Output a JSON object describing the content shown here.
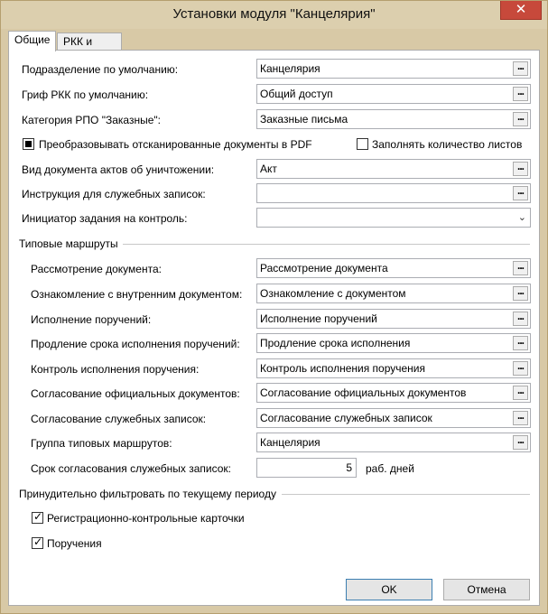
{
  "window": {
    "title": "Установки модуля \"Канцелярия\"",
    "close_glyph": "✕"
  },
  "tabs": [
    {
      "label": "Общие"
    },
    {
      "label": "РКК и поручения"
    }
  ],
  "general": {
    "default_department": {
      "label": "Подразделение по умолчанию:",
      "value": "Канцелярия"
    },
    "default_security": {
      "label": "Гриф РКК по умолчанию:",
      "value": "Общий доступ"
    },
    "rpo_category": {
      "label": "Категория РПО \"Заказные\":",
      "value": "Заказные письма"
    },
    "convert_pdf": {
      "label": "Преобразовывать отсканированные документы в PDF",
      "state": "indeterminate"
    },
    "fill_sheets": {
      "label": "Заполнять количество листов",
      "checked": false
    },
    "destruction_act_type": {
      "label": "Вид документа актов об уничтожении:",
      "value": "Акт"
    },
    "memo_instruction": {
      "label": "Инструкция для служебных записок:",
      "value": ""
    },
    "control_initiator": {
      "label": "Инициатор задания на контроль:",
      "value": ""
    }
  },
  "routes": {
    "group_label": "Типовые маршруты",
    "items": [
      {
        "label": "Рассмотрение документа:",
        "value": "Рассмотрение документа"
      },
      {
        "label": "Ознакомление с внутренним документом:",
        "value": "Ознакомление с документом"
      },
      {
        "label": "Исполнение поручений:",
        "value": "Исполнение поручений"
      },
      {
        "label": "Продление срока исполнения поручений:",
        "value": "Продление срока исполнения"
      },
      {
        "label": "Контроль исполнения поручения:",
        "value": "Контроль исполнения поручения"
      },
      {
        "label": "Согласование официальных документов:",
        "value": "Согласование официальных документов"
      },
      {
        "label": "Согласование служебных записок:",
        "value": "Согласование служебных записок"
      },
      {
        "label": "Группа типовых маршрутов:",
        "value": "Канцелярия"
      }
    ],
    "approval_term": {
      "label": "Срок согласования служебных записок:",
      "value": "5",
      "unit": "раб. дней"
    }
  },
  "filter": {
    "group_label": "Принудительно фильтровать по текущему периоду",
    "rkk": {
      "label": "Регистрационно-контрольные карточки",
      "checked": true
    },
    "orders": {
      "label": "Поручения",
      "checked": true
    }
  },
  "buttons": {
    "ok": "OK",
    "cancel": "Отмена"
  },
  "icons": {
    "ellipsis": "...",
    "dropdown": "⌄"
  },
  "colors": {
    "frame": "#d8c9a6",
    "close": "#c7493b",
    "focus_border": "#3c7fb1"
  }
}
